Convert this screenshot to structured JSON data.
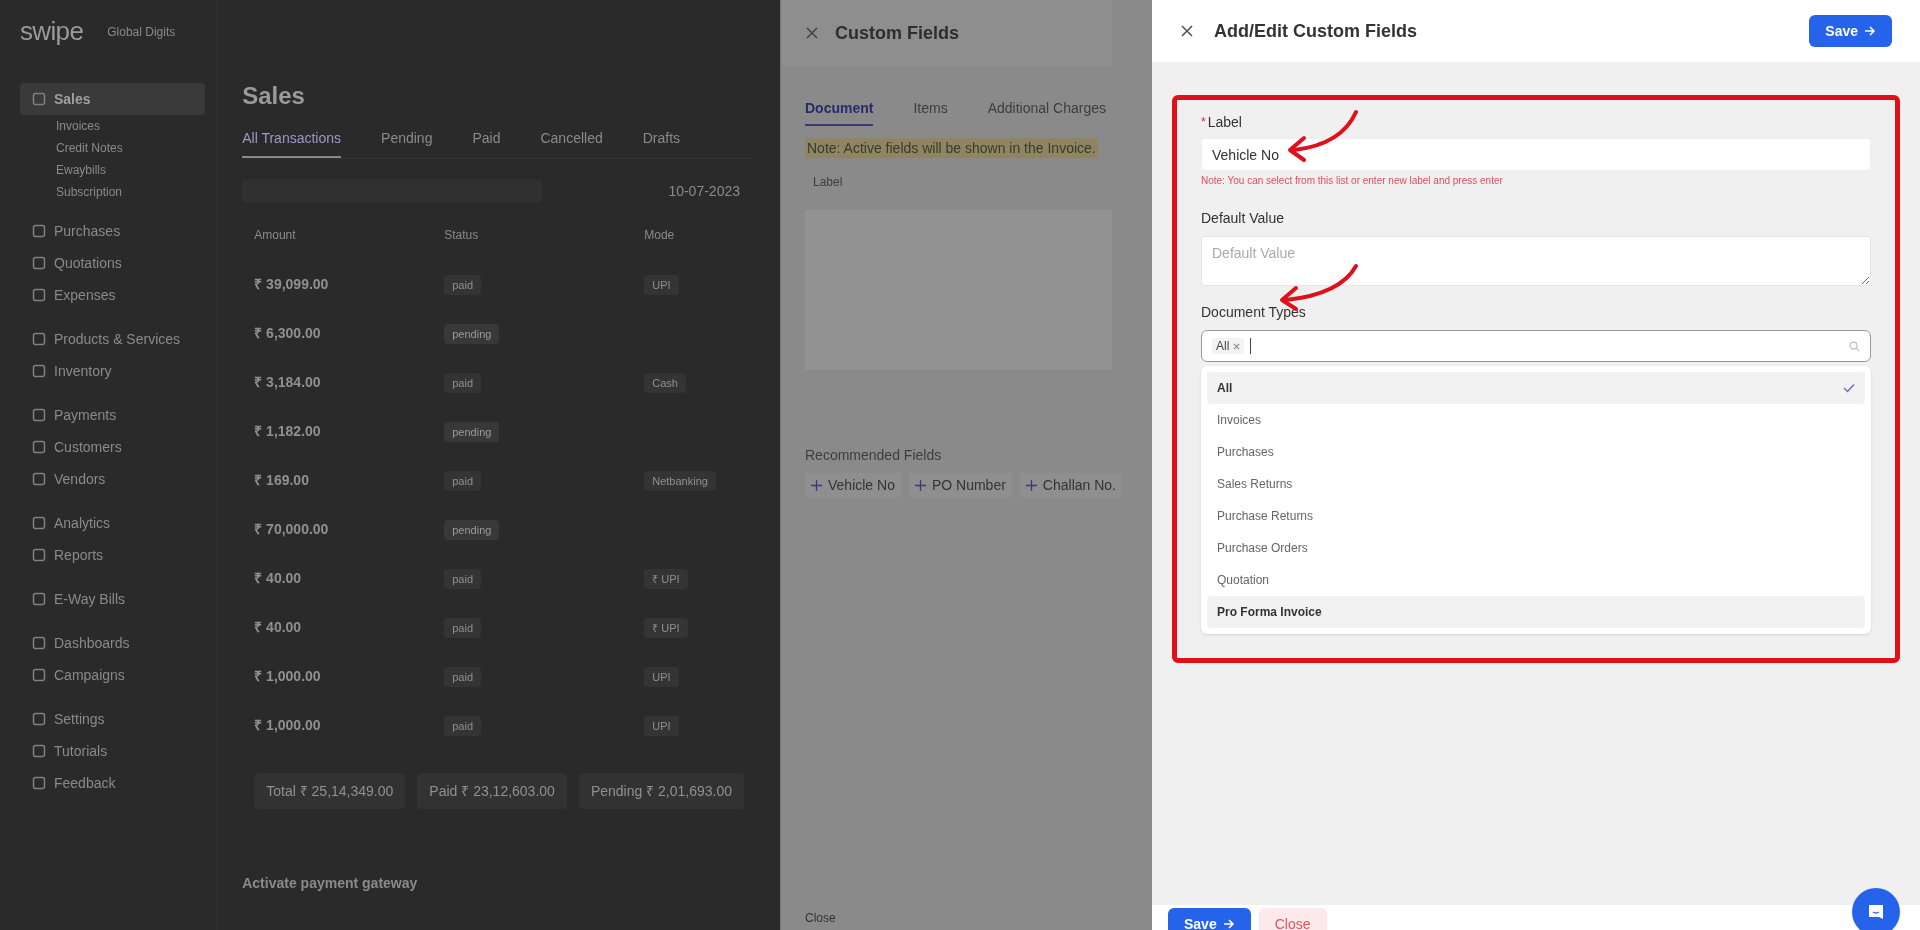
{
  "app": {
    "logo": "swipe",
    "company": "Global Digits",
    "sidebar": [
      {
        "label": "Sales",
        "selected": true,
        "children": [
          {
            "label": "Invoices"
          },
          {
            "label": "Credit Notes"
          },
          {
            "label": "Ewaybills"
          },
          {
            "label": "Subscription"
          }
        ]
      },
      {
        "label": "Purchases",
        "selected": false
      },
      {
        "label": "Quotations",
        "selected": false
      },
      {
        "label": "Expenses",
        "selected": false
      },
      {
        "label": "Products & Services",
        "selected": false
      },
      {
        "label": "Inventory",
        "selected": false
      },
      {
        "label": "Payments",
        "selected": false
      },
      {
        "label": "Customers",
        "selected": false
      },
      {
        "label": "Vendors",
        "selected": false
      },
      {
        "label": "Analytics",
        "selected": false
      },
      {
        "label": "Reports",
        "selected": false
      },
      {
        "label": "E-Way Bills",
        "selected": false
      },
      {
        "label": "Dashboards",
        "selected": false
      },
      {
        "label": "Campaigns",
        "selected": false
      },
      {
        "label": "Settings",
        "selected": false
      },
      {
        "label": "Tutorials",
        "selected": false
      },
      {
        "label": "Feedback",
        "selected": false
      }
    ],
    "page_title": "Sales",
    "tabs": [
      {
        "label": "All Transactions",
        "selected": true
      },
      {
        "label": "Pending",
        "selected": false
      },
      {
        "label": "Paid",
        "selected": false
      },
      {
        "label": "Cancelled",
        "selected": false
      },
      {
        "label": "Drafts",
        "selected": false
      }
    ],
    "date": "10-07-2023",
    "table": {
      "columns": [
        "Amount",
        "Status",
        "Mode"
      ],
      "rows": [
        {
          "amount": "₹ 39,099.00",
          "status": "paid",
          "mode": "UPI"
        },
        {
          "amount": "₹ 6,300.00",
          "status": "pending"
        },
        {
          "amount": "₹ 3,184.00",
          "status": "paid",
          "mode": "Cash"
        },
        {
          "amount": "₹ 1,182.00",
          "status": "pending"
        },
        {
          "amount": "₹ 169.00",
          "status": "paid",
          "mode": "Netbanking"
        },
        {
          "amount": "₹ 70,000.00",
          "status": "pending"
        },
        {
          "amount": "₹ 40.00",
          "status": "paid",
          "mode": "₹ UPI"
        },
        {
          "amount": "₹ 40.00",
          "status": "paid",
          "mode": "₹ UPI"
        },
        {
          "amount": "₹ 1,000.00",
          "status": "paid",
          "mode": "UPI"
        },
        {
          "amount": "₹ 1,000.00",
          "status": "paid",
          "mode": "UPI"
        }
      ]
    },
    "totals": [
      "Total ₹ 25,14,349.00",
      "Paid ₹ 23,12,603.00",
      "Pending ₹ 2,01,693.00"
    ],
    "gateway_title": "Activate payment gateway"
  },
  "custom_fields": {
    "title": "Custom Fields",
    "tabs": [
      {
        "label": "Document",
        "selected": true
      },
      {
        "label": "Items",
        "selected": false
      },
      {
        "label": "Additional Charges",
        "selected": false
      }
    ],
    "note": "Note: Active fields will be shown in the Invoice.",
    "label_header": "Label",
    "recommended_title": "Recommended Fields",
    "recommended": [
      "Vehicle No",
      "PO Number",
      "Challan No."
    ],
    "footer_button": "Close"
  },
  "edit_panel": {
    "title": "Add/Edit Custom Fields",
    "save": "Save",
    "label": {
      "title": "Label",
      "required_mark": "*",
      "value": "Vehicle No",
      "note": "Note: You can select from this list or enter new label and press enter"
    },
    "default_value": {
      "title": "Default Value",
      "placeholder": "Default Value"
    },
    "document_types": {
      "title": "Document Types",
      "tags": [
        "All"
      ],
      "options": [
        {
          "label": "All",
          "selected": true,
          "highlighted": true
        },
        {
          "label": "Invoices",
          "selected": false,
          "highlighted": false
        },
        {
          "label": "Purchases",
          "selected": false,
          "highlighted": false
        },
        {
          "label": "Sales Returns",
          "selected": false,
          "highlighted": false
        },
        {
          "label": "Purchase Returns",
          "selected": false,
          "highlighted": false
        },
        {
          "label": "Purchase Orders",
          "selected": false,
          "highlighted": false
        },
        {
          "label": "Quotation",
          "selected": false,
          "highlighted": false
        },
        {
          "label": "Pro Forma Invoice",
          "selected": false,
          "highlighted": true
        }
      ]
    },
    "footer": {
      "save": "Save",
      "close": "Close"
    }
  }
}
